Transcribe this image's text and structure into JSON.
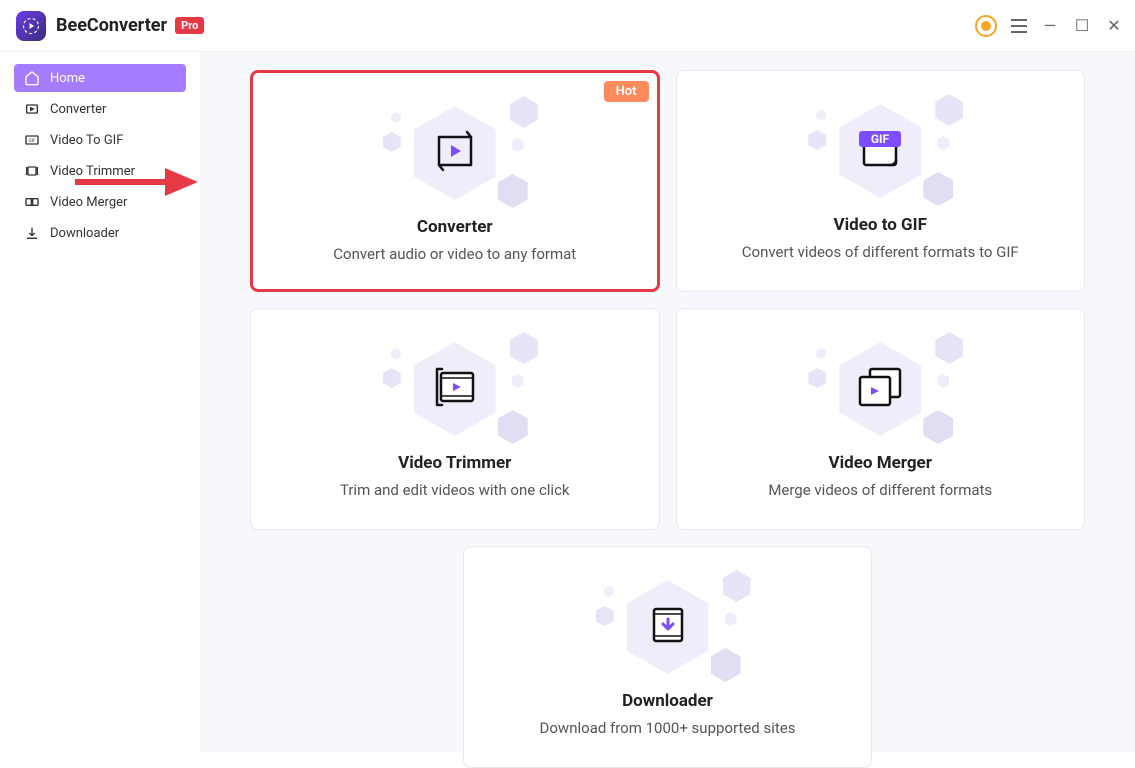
{
  "app": {
    "title": "BeeConverter",
    "badge": "Pro"
  },
  "sidebar": {
    "items": [
      {
        "label": "Home",
        "icon": "home-icon",
        "active": true
      },
      {
        "label": "Converter",
        "icon": "converter-icon",
        "active": false
      },
      {
        "label": "Video To GIF",
        "icon": "gif-icon",
        "active": false
      },
      {
        "label": "Video Trimmer",
        "icon": "trimmer-icon",
        "active": false
      },
      {
        "label": "Video Merger",
        "icon": "merger-icon",
        "active": false
      },
      {
        "label": "Downloader",
        "icon": "downloader-icon",
        "active": false
      }
    ]
  },
  "cards": [
    {
      "title": "Converter",
      "desc": "Convert audio or video to any format",
      "hot_badge": "Hot",
      "highlighted": true
    },
    {
      "title": "Video to GIF",
      "desc": "Convert videos of different formats to GIF"
    },
    {
      "title": "Video Trimmer",
      "desc": "Trim and edit videos with one click"
    },
    {
      "title": "Video Merger",
      "desc": "Merge videos of different formats"
    },
    {
      "title": "Downloader",
      "desc": "Download from 1000+ supported sites"
    }
  ],
  "colors": {
    "accent": "#a57bff",
    "danger": "#e63946",
    "hot": "#ff8a5c",
    "user": "#f5a623"
  }
}
